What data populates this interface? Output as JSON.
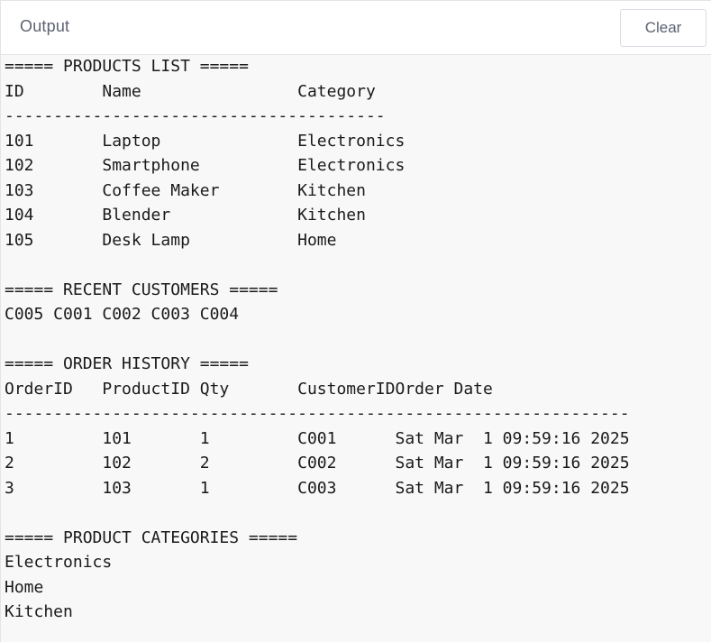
{
  "header": {
    "title": "Output",
    "clear_label": "Clear"
  },
  "console": {
    "lines": [
      "===== PRODUCTS LIST =====",
      "ID        Name                Category",
      "---------------------------------------",
      "101       Laptop              Electronics",
      "102       Smartphone          Electronics",
      "103       Coffee Maker        Kitchen",
      "104       Blender             Kitchen",
      "105       Desk Lamp           Home",
      "",
      "===== RECENT CUSTOMERS =====",
      "C005 C001 C002 C003 C004",
      "",
      "===== ORDER HISTORY =====",
      "OrderID   ProductID Qty       CustomerIDOrder Date",
      "----------------------------------------------------------------",
      "1         101       1         C001      Sat Mar  1 09:59:16 2025",
      "2         102       2         C002      Sat Mar  1 09:59:16 2025",
      "3         103       1         C003      Sat Mar  1 09:59:16 2025",
      "",
      "===== PRODUCT CATEGORIES =====",
      "Electronics",
      "Home",
      "Kitchen"
    ]
  }
}
